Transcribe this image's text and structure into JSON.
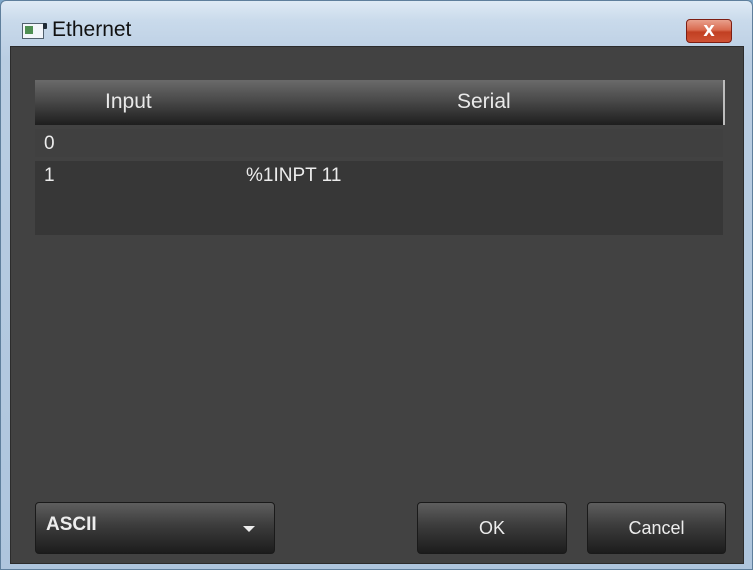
{
  "window": {
    "title": "Ethernet",
    "close_label": "X"
  },
  "table": {
    "columns": [
      "Input",
      "Serial"
    ],
    "rows": [
      {
        "input": "0",
        "serial": ""
      },
      {
        "input": "1",
        "serial": "%1INPT 11"
      }
    ]
  },
  "footer": {
    "encoding_value": "ASCII",
    "ok_label": "OK",
    "cancel_label": "Cancel"
  },
  "icons": {
    "app": "window-app-icon",
    "dropdown": "chevron-down-icon"
  },
  "colors": {
    "panel_bg": "#424242",
    "header_bg": "#1e1e1e",
    "text": "#ececec",
    "close_red": "#c13f22"
  }
}
